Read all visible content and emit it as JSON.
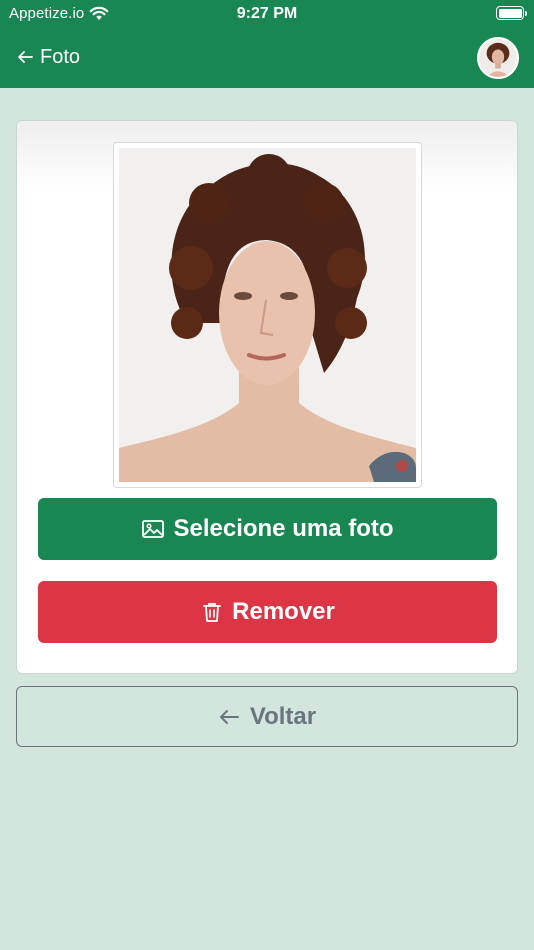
{
  "status_bar": {
    "carrier": "Appetize.io",
    "time": "9:27 PM"
  },
  "header": {
    "back_icon": "arrow-left-icon",
    "title": "Foto",
    "avatar_icon": "user-avatar"
  },
  "photo": {
    "alt": "Foto do usuário"
  },
  "actions": {
    "select_icon": "image-icon",
    "select_label": "Selecione uma foto",
    "remove_icon": "trash-icon",
    "remove_label": "Remover",
    "back_icon": "arrow-left-icon",
    "back_label": "Voltar"
  },
  "colors": {
    "primary": "#198754",
    "danger": "#dc3545",
    "secondary": "#6c757d",
    "background": "#d2e6de"
  }
}
